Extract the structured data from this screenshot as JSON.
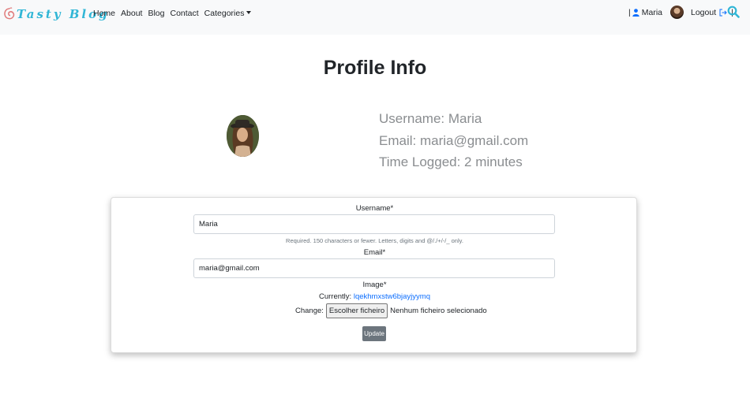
{
  "brand": {
    "name": "Tasty Blog",
    "accent": "#31b6d6"
  },
  "nav": {
    "items": [
      "Home",
      "About",
      "Blog",
      "Contact"
    ],
    "categories_label": "Categories",
    "separator": "|",
    "username": "Maria",
    "logout_label": "Logout",
    "trailing_separator": "|"
  },
  "profile": {
    "title": "Profile Info",
    "username_line": "Username: Maria",
    "email_line": "Email: maria@gmail.com",
    "time_line": "Time Logged: 2 minutes"
  },
  "form": {
    "username_label": "Username*",
    "username_value": "Maria",
    "username_help": "Required. 150 characters or fewer. Letters, digits and @/./+/-/_ only.",
    "email_label": "Email*",
    "email_value": "maria@gmail.com",
    "image_label": "Image*",
    "currently_label": "Currently:",
    "current_file": "lqekhmxstw6bjayjyymq",
    "change_label": "Change:",
    "choose_file_label": "Escolher ficheiro",
    "no_file_label": "Nenhum ficheiro selecionado",
    "update_label": "Update"
  },
  "icons": {
    "logo": "swirl-logo-icon",
    "user": "user-icon",
    "logout": "logout-icon",
    "search": "search-icon"
  }
}
